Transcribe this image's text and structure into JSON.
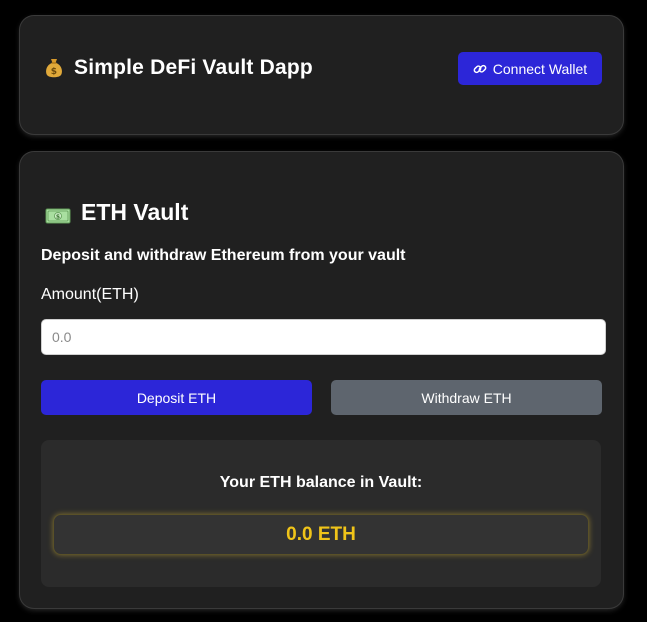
{
  "header": {
    "title": "Simple DeFi Vault Dapp",
    "title_icon": "money-bag-icon",
    "connect_button": {
      "label": "Connect Wallet",
      "icon": "link-icon"
    }
  },
  "vault": {
    "title": "ETH Vault",
    "title_icon": "banknote-icon",
    "subtitle": "Deposit and withdraw Ethereum from your vault",
    "amount_label": "Amount(ETH)",
    "amount_input": {
      "value": "",
      "placeholder": "0.0"
    },
    "deposit_label": "Deposit ETH",
    "withdraw_label": "Withdraw ETH",
    "balance": {
      "label": "Your ETH balance in Vault:",
      "value": "0.0 ETH"
    }
  },
  "colors": {
    "background": "#000000",
    "card": "#202020",
    "primary_button": "#2c26d8",
    "secondary_button": "#5e656e",
    "balance_text": "#f0c419"
  }
}
